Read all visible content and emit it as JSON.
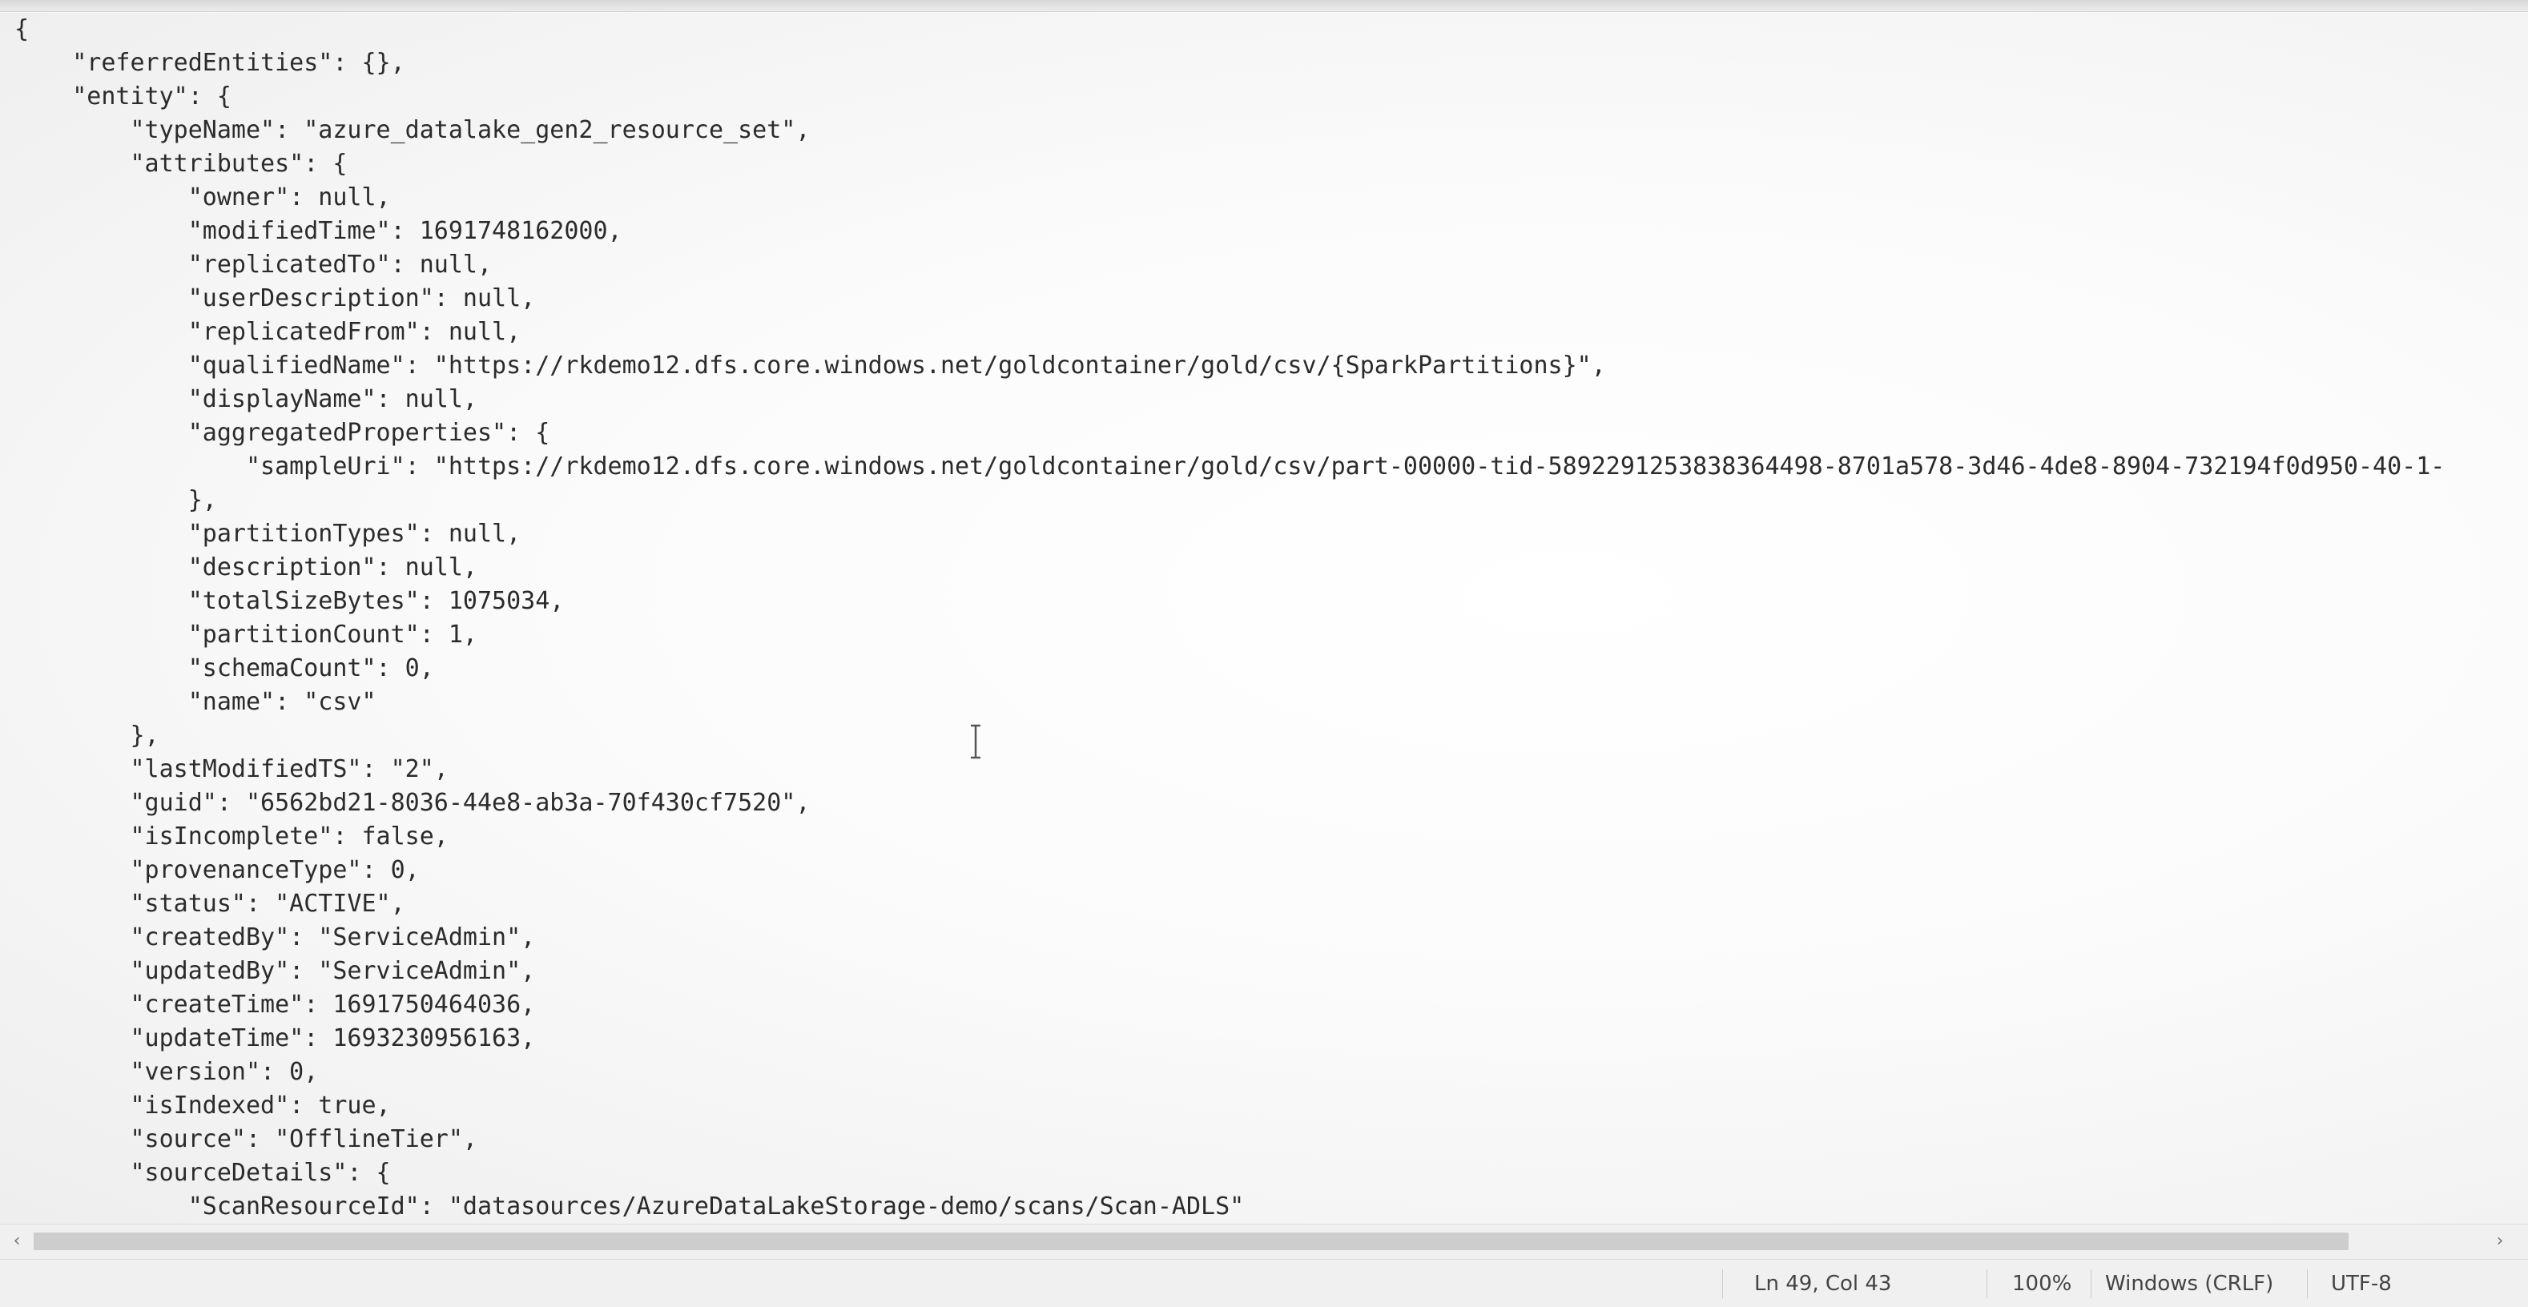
{
  "editor": {
    "lines": [
      "{",
      "    \"referredEntities\": {},",
      "    \"entity\": {",
      "        \"typeName\": \"azure_datalake_gen2_resource_set\",",
      "        \"attributes\": {",
      "            \"owner\": null,",
      "            \"modifiedTime\": 1691748162000,",
      "            \"replicatedTo\": null,",
      "            \"userDescription\": null,",
      "            \"replicatedFrom\": null,",
      "            \"qualifiedName\": \"https://rkdemo12.dfs.core.windows.net/goldcontainer/gold/csv/{SparkPartitions}\",",
      "            \"displayName\": null,",
      "            \"aggregatedProperties\": {",
      "                \"sampleUri\": \"https://rkdemo12.dfs.core.windows.net/goldcontainer/gold/csv/part-00000-tid-5892291253838364498-8701a578-3d46-4de8-8904-732194f0d950-40-1-",
      "            },",
      "            \"partitionTypes\": null,",
      "            \"description\": null,",
      "            \"totalSizeBytes\": 1075034,",
      "            \"partitionCount\": 1,",
      "            \"schemaCount\": 0,",
      "            \"name\": \"csv\"",
      "        },",
      "        \"lastModifiedTS\": \"2\",",
      "        \"guid\": \"6562bd21-8036-44e8-ab3a-70f430cf7520\",",
      "        \"isIncomplete\": false,",
      "        \"provenanceType\": 0,",
      "        \"status\": \"ACTIVE\",",
      "        \"createdBy\": \"ServiceAdmin\",",
      "        \"updatedBy\": \"ServiceAdmin\",",
      "        \"createTime\": 1691750464036,",
      "        \"updateTime\": 1693230956163,",
      "        \"version\": 0,",
      "        \"isIndexed\": true,",
      "        \"source\": \"OfflineTier\",",
      "        \"sourceDetails\": {",
      "            \"ScanResourceId\": \"datasources/AzureDataLakeStorage-demo/scans/Scan-ADLS\""
    ]
  },
  "statusbar": {
    "cursor_position": "Ln 49, Col 43",
    "zoom": "100%",
    "line_ending": "Windows (CRLF)",
    "encoding": "UTF-8"
  },
  "scrollbar": {
    "left_arrow": "‹",
    "right_arrow": "›"
  }
}
